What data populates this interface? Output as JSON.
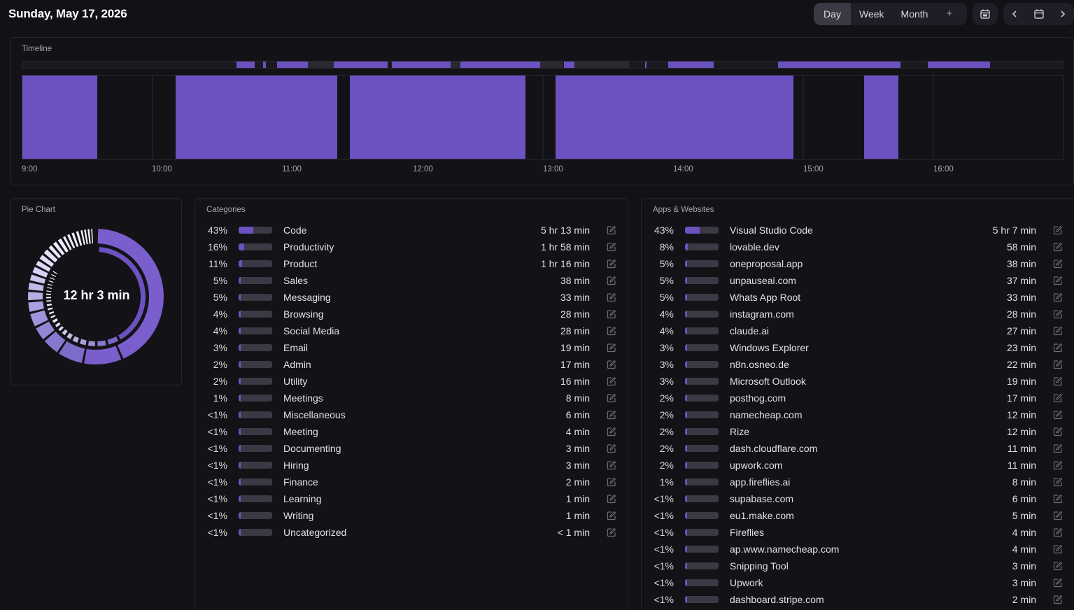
{
  "header": {
    "date": "Sunday, May 17, 2026",
    "views": [
      {
        "label": "Day",
        "active": true
      },
      {
        "label": "Week",
        "active": false
      },
      {
        "label": "Month",
        "active": false
      }
    ],
    "add_label": "+"
  },
  "timeline": {
    "title": "Timeline",
    "ticks": [
      "9:00",
      "10:00",
      "11:00",
      "12:00",
      "13:00",
      "14:00",
      "15:00",
      "16:00"
    ],
    "accent": "#6b52c0"
  },
  "pie": {
    "title": "Pie Chart",
    "total": "12 hr 3 min"
  },
  "categories": {
    "title": "Categories",
    "rows": [
      {
        "pct": "43%",
        "fill": 0.43,
        "name": "Code",
        "dur": "5 hr 13 min"
      },
      {
        "pct": "16%",
        "fill": 0.16,
        "name": "Productivity",
        "dur": "1 hr 58 min"
      },
      {
        "pct": "11%",
        "fill": 0.11,
        "name": "Product",
        "dur": "1 hr 16 min"
      },
      {
        "pct": "5%",
        "fill": 0.05,
        "name": "Sales",
        "dur": "38 min"
      },
      {
        "pct": "5%",
        "fill": 0.05,
        "name": "Messaging",
        "dur": "33 min"
      },
      {
        "pct": "4%",
        "fill": 0.04,
        "name": "Browsing",
        "dur": "28 min"
      },
      {
        "pct": "4%",
        "fill": 0.04,
        "name": "Social Media",
        "dur": "28 min"
      },
      {
        "pct": "3%",
        "fill": 0.03,
        "name": "Email",
        "dur": "19 min"
      },
      {
        "pct": "2%",
        "fill": 0.02,
        "name": "Admin",
        "dur": "17 min"
      },
      {
        "pct": "2%",
        "fill": 0.02,
        "name": "Utility",
        "dur": "16 min"
      },
      {
        "pct": "1%",
        "fill": 0.01,
        "name": "Meetings",
        "dur": "8 min"
      },
      {
        "pct": "<1%",
        "fill": 0.005,
        "name": "Miscellaneous",
        "dur": "6 min"
      },
      {
        "pct": "<1%",
        "fill": 0.005,
        "name": "Meeting",
        "dur": "4 min"
      },
      {
        "pct": "<1%",
        "fill": 0.005,
        "name": "Documenting",
        "dur": "3 min"
      },
      {
        "pct": "<1%",
        "fill": 0.005,
        "name": "Hiring",
        "dur": "3 min"
      },
      {
        "pct": "<1%",
        "fill": 0.005,
        "name": "Finance",
        "dur": "2 min"
      },
      {
        "pct": "<1%",
        "fill": 0.005,
        "name": "Learning",
        "dur": "1 min"
      },
      {
        "pct": "<1%",
        "fill": 0.005,
        "name": "Writing",
        "dur": "1 min"
      },
      {
        "pct": "<1%",
        "fill": 0.005,
        "name": "Uncategorized",
        "dur": "< 1 min"
      }
    ]
  },
  "apps": {
    "title": "Apps & Websites",
    "rows": [
      {
        "pct": "43%",
        "fill": 0.43,
        "name": "Visual Studio Code",
        "dur": "5 hr 7 min"
      },
      {
        "pct": "8%",
        "fill": 0.08,
        "name": "lovable.dev",
        "dur": "58 min"
      },
      {
        "pct": "5%",
        "fill": 0.05,
        "name": "oneproposal.app",
        "dur": "38 min"
      },
      {
        "pct": "5%",
        "fill": 0.05,
        "name": "unpauseai.com",
        "dur": "37 min"
      },
      {
        "pct": "5%",
        "fill": 0.05,
        "name": "Whats App Root",
        "dur": "33 min"
      },
      {
        "pct": "4%",
        "fill": 0.04,
        "name": "instagram.com",
        "dur": "28 min"
      },
      {
        "pct": "4%",
        "fill": 0.04,
        "name": "claude.ai",
        "dur": "27 min"
      },
      {
        "pct": "3%",
        "fill": 0.03,
        "name": "Windows Explorer",
        "dur": "23 min"
      },
      {
        "pct": "3%",
        "fill": 0.03,
        "name": "n8n.osneo.de",
        "dur": "22 min"
      },
      {
        "pct": "3%",
        "fill": 0.03,
        "name": "Microsoft Outlook",
        "dur": "19 min"
      },
      {
        "pct": "2%",
        "fill": 0.02,
        "name": "posthog.com",
        "dur": "17 min"
      },
      {
        "pct": "2%",
        "fill": 0.02,
        "name": "namecheap.com",
        "dur": "12 min"
      },
      {
        "pct": "2%",
        "fill": 0.02,
        "name": "Rize",
        "dur": "12 min"
      },
      {
        "pct": "2%",
        "fill": 0.02,
        "name": "dash.cloudflare.com",
        "dur": "11 min"
      },
      {
        "pct": "2%",
        "fill": 0.02,
        "name": "upwork.com",
        "dur": "11 min"
      },
      {
        "pct": "1%",
        "fill": 0.01,
        "name": "app.fireflies.ai",
        "dur": "8 min"
      },
      {
        "pct": "<1%",
        "fill": 0.005,
        "name": "supabase.com",
        "dur": "6 min"
      },
      {
        "pct": "<1%",
        "fill": 0.005,
        "name": "eu1.make.com",
        "dur": "5 min"
      },
      {
        "pct": "<1%",
        "fill": 0.005,
        "name": "Fireflies",
        "dur": "4 min"
      },
      {
        "pct": "<1%",
        "fill": 0.005,
        "name": "ap.www.namecheap.com",
        "dur": "4 min"
      },
      {
        "pct": "<1%",
        "fill": 0.005,
        "name": "Snipping Tool",
        "dur": "3 min"
      },
      {
        "pct": "<1%",
        "fill": 0.005,
        "name": "Upwork",
        "dur": "3 min"
      },
      {
        "pct": "<1%",
        "fill": 0.005,
        "name": "dashboard.stripe.com",
        "dur": "2 min"
      }
    ]
  }
}
